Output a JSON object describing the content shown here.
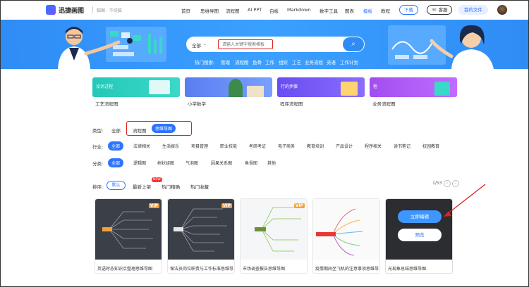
{
  "topbar": {
    "brand": "迅捷画图",
    "slogan": "脑图 · 不烧脑",
    "nav": [
      "首页",
      "思维导图",
      "流程图",
      "AI PPT",
      "白板",
      "Markdown",
      "数字工具",
      "图表",
      "模板",
      "教程"
    ],
    "active_nav": "模板",
    "download_label": "下载",
    "service_label": "客服",
    "my_files_label": "我的文件"
  },
  "search": {
    "scope": "全部",
    "placeholder": "请输入关键字搜索模板",
    "hot_label": "热门搜索:",
    "hot_terms": [
      "管理",
      "流程图",
      "鱼骨",
      "工作",
      "组织",
      "工艺",
      "业务流程",
      "英语",
      "工作计划"
    ]
  },
  "top_cards": [
    {
      "banner": "设计过程",
      "title": "工艺流程图"
    },
    {
      "banner": "",
      "title": "小学数学"
    },
    {
      "banner": "行的步骤",
      "title": "程序流程图"
    },
    {
      "banner": "程",
      "title": "业务流程图"
    }
  ],
  "filters": {
    "type_label": "类型:",
    "types": [
      "全部",
      "流程图",
      "思维导图"
    ],
    "active_type": "思维导图",
    "industry_label": "行业:",
    "industries": [
      "全部",
      "法律相关",
      "生活娱乐",
      "项目管理",
      "职业技能",
      "考研考证",
      "电子商务",
      "教育培训",
      "产品设计",
      "程序相关",
      "读书笔记",
      "校园教育"
    ],
    "category_label": "分类:",
    "categories": [
      "全部",
      "逻辑图",
      "树状组图",
      "气泡图",
      "因果关系图",
      "鱼骨图",
      "其他"
    ],
    "sort_label": "排序:",
    "sorts": [
      "默认",
      "最新上架",
      "热门精确",
      "热门收藏"
    ],
    "new_badge": "NEW"
  },
  "pager": {
    "text": "1/53"
  },
  "templates": [
    {
      "title": "英语时态知识点整理思维导图",
      "vip": "VIP"
    },
    {
      "title": "保洁员岗位职责与工作标准思维导图",
      "vip": "VIP"
    },
    {
      "title": "市场调查报告思维导图",
      "vip": "VIP"
    },
    {
      "title": "疫情期间坐飞机的注意事项思维导图",
      "vip": "VIP"
    },
    {
      "title": "光现象总结思维导图",
      "vip": ""
    }
  ],
  "hover_actions": {
    "edit_label": "立即编辑",
    "preview_label": "预览"
  },
  "colors": {
    "accent": "#2f74ff",
    "banner": "#3a9bff",
    "annotation": "#dd2222",
    "vip": "#f3a03c"
  }
}
